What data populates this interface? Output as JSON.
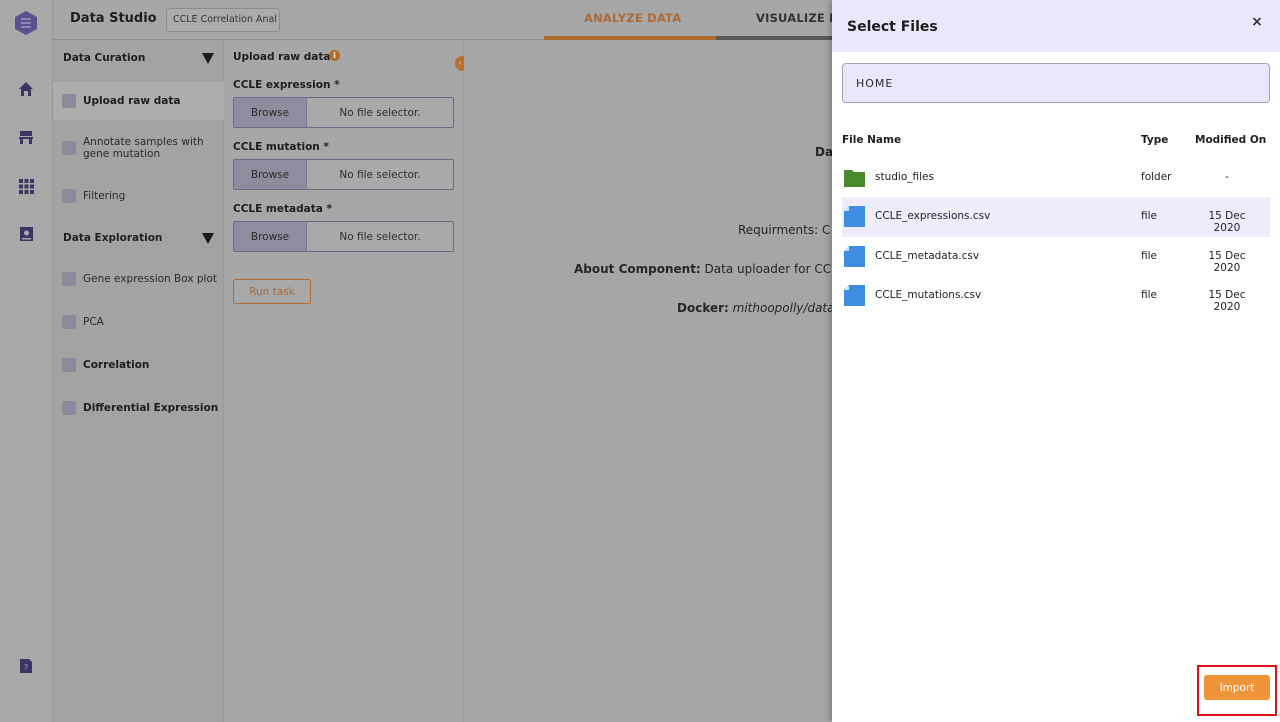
{
  "rail": {
    "icons": [
      "logo-icon",
      "home-icon",
      "workspace-icon",
      "grid-icon",
      "notebook-icon",
      "help-icon"
    ]
  },
  "topbar": {
    "app_title": "Data Studio",
    "project_name": "CCLE Correlation Anal",
    "tabs": [
      {
        "label": "ANALYZE DATA",
        "active": true
      },
      {
        "label": "VISUALIZE D"
      }
    ]
  },
  "workflow": {
    "sections": [
      {
        "label": "Data Curation",
        "items": [
          {
            "label": "Upload raw data",
            "bold": true,
            "active": true
          },
          {
            "label": "Annotate samples with gene mutation"
          },
          {
            "label": "Filtering"
          }
        ]
      },
      {
        "label": "Data Exploration",
        "items": [
          {
            "label": "Gene expression Box plot"
          },
          {
            "label": "PCA"
          },
          {
            "label": "Correlation",
            "bold": true
          },
          {
            "label": "Differential Expression",
            "bold": true
          }
        ]
      }
    ]
  },
  "panel": {
    "title": "Upload raw data",
    "info_glyph": "i",
    "collapse_glyph": "‹ ›",
    "fields": [
      {
        "label": "CCLE expression *",
        "browse": "Browse",
        "placeholder": "No file selector."
      },
      {
        "label": "CCLE mutation *",
        "browse": "Browse",
        "placeholder": "No file selector."
      },
      {
        "label": "CCLE metadata *",
        "browse": "Browse",
        "placeholder": "No file selector."
      }
    ],
    "run_label": "Run task"
  },
  "content": {
    "line1": "Da",
    "line2": "Requirments: C",
    "about_label": "About Component:",
    "about_value": " Data uploader for CCL",
    "docker_label": "Docker:",
    "docker_value": " mithoopolly/data"
  },
  "modal": {
    "title": "Select Files",
    "close_glyph": "×",
    "path": "HOME",
    "columns": {
      "name": "File Name",
      "type": "Type",
      "modified": "Modified On"
    },
    "files": [
      {
        "name": "studio_files",
        "type": "folder",
        "modified": "-",
        "icon": "folder-icon"
      },
      {
        "name": "CCLE_expressions.csv",
        "type": "file",
        "modified": "15 Dec 2020",
        "icon": "file-icon",
        "selected": true
      },
      {
        "name": "CCLE_metadata.csv",
        "type": "file",
        "modified": "15 Dec 2020",
        "icon": "file-icon"
      },
      {
        "name": "CCLE_mutations.csv",
        "type": "file",
        "modified": "15 Dec 2020",
        "icon": "file-icon"
      }
    ],
    "import_label": "Import"
  },
  "colors": {
    "accent_orange": "#f0943a",
    "folder_green": "#4a8a2e",
    "file_blue": "#3d8ee0",
    "modal_tint": "#eae7fa",
    "highlight_red": "#e0101a"
  }
}
